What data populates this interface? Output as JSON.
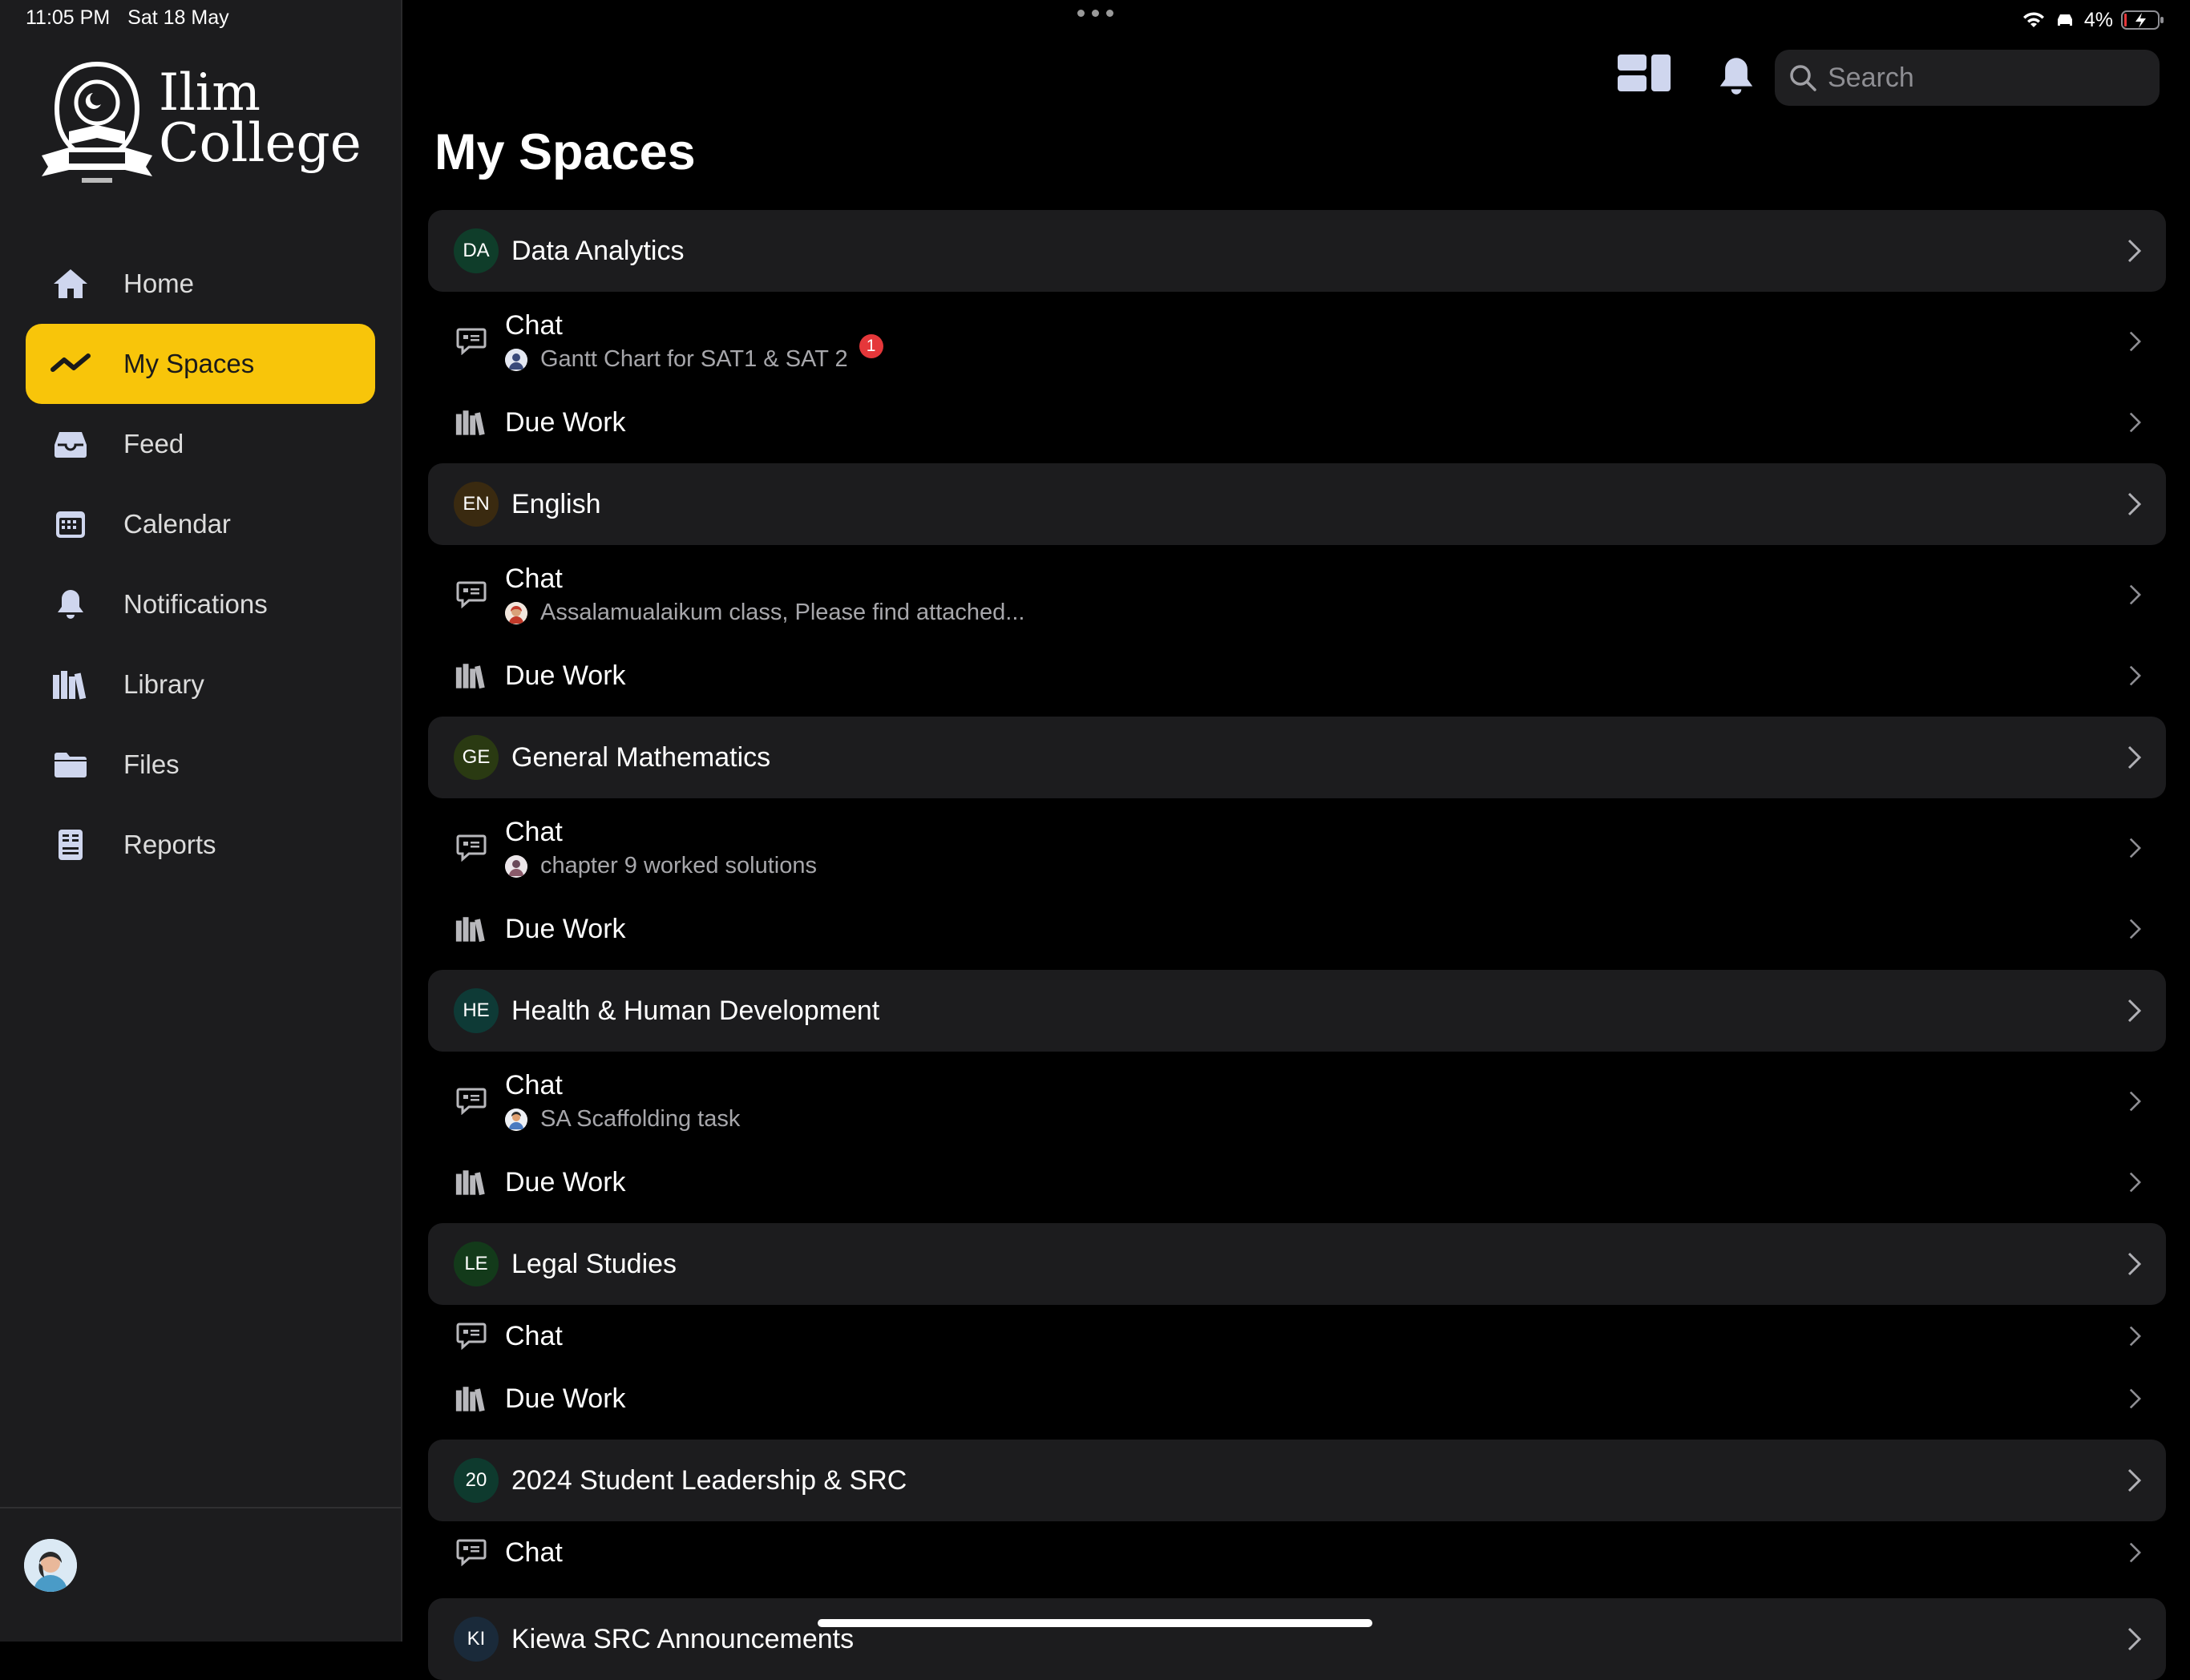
{
  "status_bar": {
    "time": "11:05 PM",
    "date": "Sat 18 May",
    "battery": "4%"
  },
  "brand": {
    "line1": "Ilim",
    "line2": "College"
  },
  "nav": {
    "home": "Home",
    "my_spaces": "My Spaces",
    "feed": "Feed",
    "calendar": "Calendar",
    "notifications": "Notifications",
    "library": "Library",
    "files": "Files",
    "reports": "Reports"
  },
  "search": {
    "placeholder": "Search"
  },
  "page": {
    "title": "My Spaces"
  },
  "colors": {
    "accent": "#f8c50a",
    "notification": "#e5373a"
  },
  "spaces": [
    {
      "badge": "DA",
      "name": "Data Analytics",
      "chat": "Chat",
      "preview": "Gantt Chart for SAT1 & SAT 2",
      "unread": "1",
      "due": "Due Work"
    },
    {
      "badge": "EN",
      "name": "English",
      "chat": "Chat",
      "preview": "Assalamualaikum class, Please find attached...",
      "due": "Due Work"
    },
    {
      "badge": "GE",
      "name": "General Mathematics",
      "chat": "Chat",
      "preview": "chapter 9 worked solutions",
      "due": "Due Work"
    },
    {
      "badge": "HE",
      "name": "Health & Human Development",
      "chat": "Chat",
      "preview": "SA Scaffolding task",
      "due": "Due Work"
    },
    {
      "badge": "LE",
      "name": "Legal Studies",
      "chat": "Chat",
      "due": "Due Work"
    },
    {
      "badge": "20",
      "name": "2024 Student Leadership & SRC",
      "chat": "Chat"
    },
    {
      "badge": "KI",
      "name": "Kiewa SRC Announcements"
    }
  ]
}
